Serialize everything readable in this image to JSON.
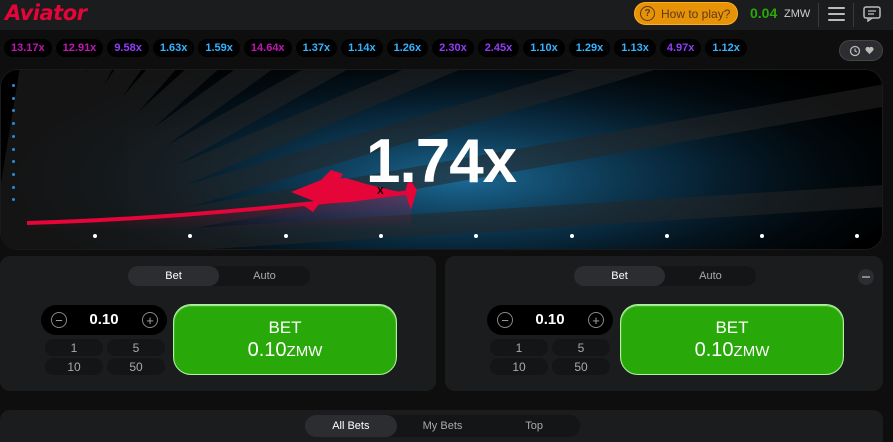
{
  "header": {
    "logo": "Aviator",
    "how_to_play": "How to play?",
    "balance": "0.04",
    "currency": "ZMW"
  },
  "history": {
    "multipliers": [
      {
        "value": "13.17x",
        "color": "#c017b4"
      },
      {
        "value": "12.91x",
        "color": "#c017b4"
      },
      {
        "value": "9.58x",
        "color": "#913ef8"
      },
      {
        "value": "1.63x",
        "color": "#34b4ff"
      },
      {
        "value": "1.59x",
        "color": "#34b4ff"
      },
      {
        "value": "14.64x",
        "color": "#c017b4"
      },
      {
        "value": "1.37x",
        "color": "#34b4ff"
      },
      {
        "value": "1.14x",
        "color": "#34b4ff"
      },
      {
        "value": "1.26x",
        "color": "#34b4ff"
      },
      {
        "value": "2.30x",
        "color": "#913ef8"
      },
      {
        "value": "2.45x",
        "color": "#913ef8"
      },
      {
        "value": "1.10x",
        "color": "#34b4ff"
      },
      {
        "value": "1.29x",
        "color": "#34b4ff"
      },
      {
        "value": "1.13x",
        "color": "#34b4ff"
      },
      {
        "value": "4.97x",
        "color": "#913ef8"
      },
      {
        "value": "1.12x",
        "color": "#34b4ff"
      }
    ]
  },
  "game": {
    "current_multiplier": "1.74x",
    "plane_color": "#e50539"
  },
  "panels": [
    {
      "tab_bet": "Bet",
      "tab_auto": "Auto",
      "amount": "0.10",
      "quick": [
        "1",
        "5",
        "10",
        "50"
      ],
      "bet_label": "BET",
      "bet_amount": "0.10",
      "bet_currency": "ZMW"
    },
    {
      "tab_bet": "Bet",
      "tab_auto": "Auto",
      "amount": "0.10",
      "quick": [
        "1",
        "5",
        "10",
        "50"
      ],
      "bet_label": "BET",
      "bet_amount": "0.10",
      "bet_currency": "ZMW"
    }
  ],
  "bottom_tabs": [
    "All Bets",
    "My Bets",
    "Top"
  ],
  "colors": {
    "accent_red": "#e50539",
    "bet_green": "#28a909",
    "howto_orange": "#e69308"
  }
}
